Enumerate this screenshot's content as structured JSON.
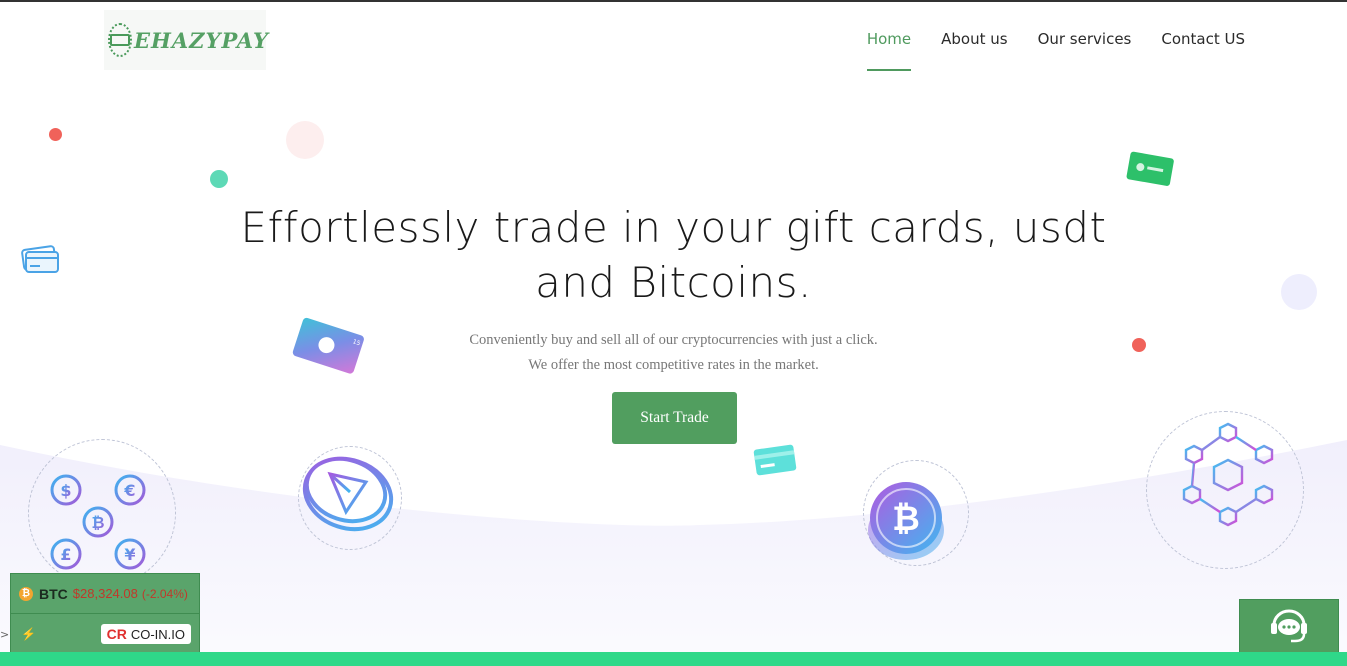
{
  "brand": {
    "name": "EHAZYPAY"
  },
  "nav": {
    "items": [
      {
        "label": "Home",
        "active": true
      },
      {
        "label": "About us",
        "active": false
      },
      {
        "label": "Our services",
        "active": false
      },
      {
        "label": "Contact US",
        "active": false
      }
    ]
  },
  "hero": {
    "title_line1": "Effortlessly trade in your gift cards, usdt",
    "title_line2": "and Bitcoins.",
    "subtitle_line1": "Conveniently buy and sell all of our cryptocurrencies with just a click.",
    "subtitle_line2": "We offer the most competitive rates in the market.",
    "cta_label": "Start Trade"
  },
  "ticker": {
    "symbol": "BTC",
    "price": "$28,324.08",
    "change": "(-2.04%)",
    "provider": "CO-IN.IO",
    "provider_mark": "ϹR"
  },
  "colors": {
    "accent": "#519e5f",
    "brand_green": "#55a064",
    "bottom_bar": "#2fd889",
    "dot_red": "#f0625a",
    "dot_teal": "#5dd9b6"
  },
  "icons": {
    "chat": "headset-chat-icon",
    "logo": "card-logo-icon"
  }
}
